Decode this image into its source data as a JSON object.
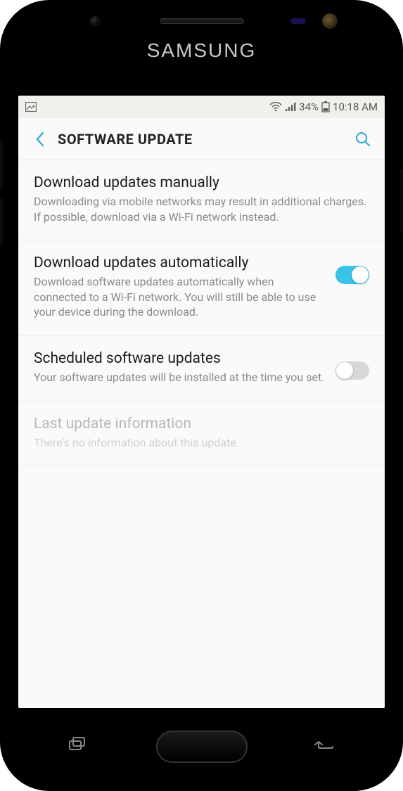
{
  "brand": "SAMSUNG",
  "statusBar": {
    "batteryPercent": "34%",
    "time": "10:18 AM"
  },
  "appBar": {
    "title": "SOFTWARE UPDATE"
  },
  "settings": [
    {
      "title": "Download updates manually",
      "desc": "Downloading via mobile networks may result in additional charges. If possible, download via a Wi-Fi network instead.",
      "toggle": null,
      "disabled": false
    },
    {
      "title": "Download updates automatically",
      "desc": "Download software updates automatically when connected to a Wi-Fi network. You will still be able to use your device during the download.",
      "toggle": true,
      "disabled": false
    },
    {
      "title": "Scheduled software updates",
      "desc": "Your software updates will be installed at the time you set.",
      "toggle": false,
      "disabled": false
    },
    {
      "title": "Last update information",
      "desc": "There's no information about this update.",
      "toggle": null,
      "disabled": true
    }
  ]
}
